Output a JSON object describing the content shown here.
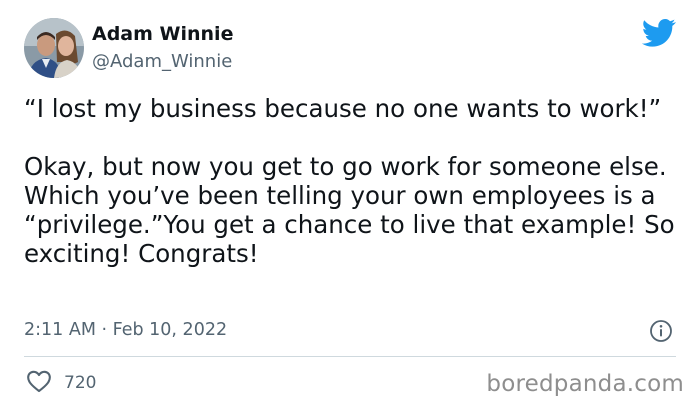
{
  "author": {
    "display_name": "Adam Winnie",
    "handle": "@Adam_Winnie",
    "avatar_icon": "profile-photo-couple"
  },
  "brand_icon": "twitter-bird-icon",
  "brand_color": "#1d9bf0",
  "tweet": {
    "quote_line": "“I lost my business because no one wants to work!”",
    "body_line": "Okay, but now you get to go work for someone else. Which you’ve been telling your own employees is a “privilege.”You get a chance to live that example! So exciting! Congrats!",
    "timestamp": "2:11 AM · Feb 10, 2022"
  },
  "stats": {
    "likes": "720"
  },
  "watermark": "boredpanda.com"
}
